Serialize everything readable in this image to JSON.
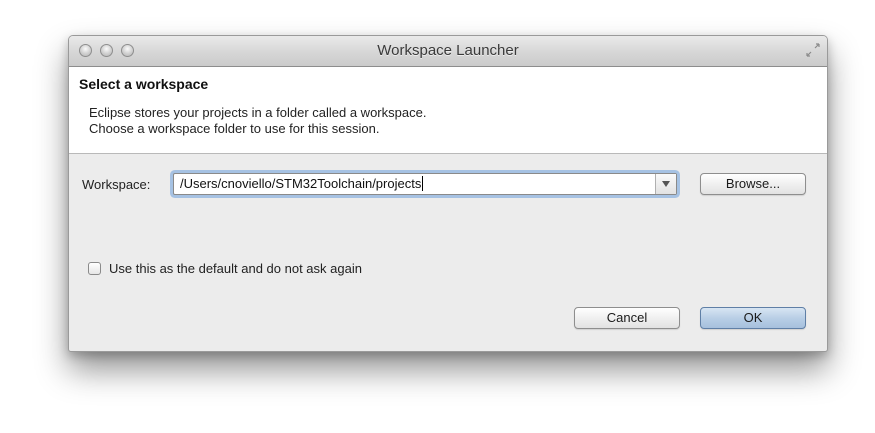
{
  "window": {
    "title": "Workspace Launcher"
  },
  "header": {
    "title": "Select a workspace",
    "line1": "Eclipse stores your projects in a folder called a workspace.",
    "line2": "Choose a workspace folder to use for this session."
  },
  "workspace": {
    "label": "Workspace:",
    "value": "/Users/cnoviello/STM32Toolchain/projects",
    "browse_label": "Browse..."
  },
  "default_checkbox": {
    "label": "Use this as the default and do not ask again",
    "checked": false
  },
  "buttons": {
    "cancel_label": "Cancel",
    "ok_label": "OK"
  },
  "icons": {
    "close": "close-traffic-light-icon",
    "minimize": "minimize-traffic-light-icon",
    "zoom": "zoom-traffic-light-icon",
    "resize": "fullscreen-resize-icon",
    "dropdown": "chevron-down-icon"
  },
  "colors": {
    "dialog_background": "#ececec",
    "header_background": "#ffffff",
    "focus_ring": "#6ea0dc",
    "default_button": "#b9cfe6"
  }
}
